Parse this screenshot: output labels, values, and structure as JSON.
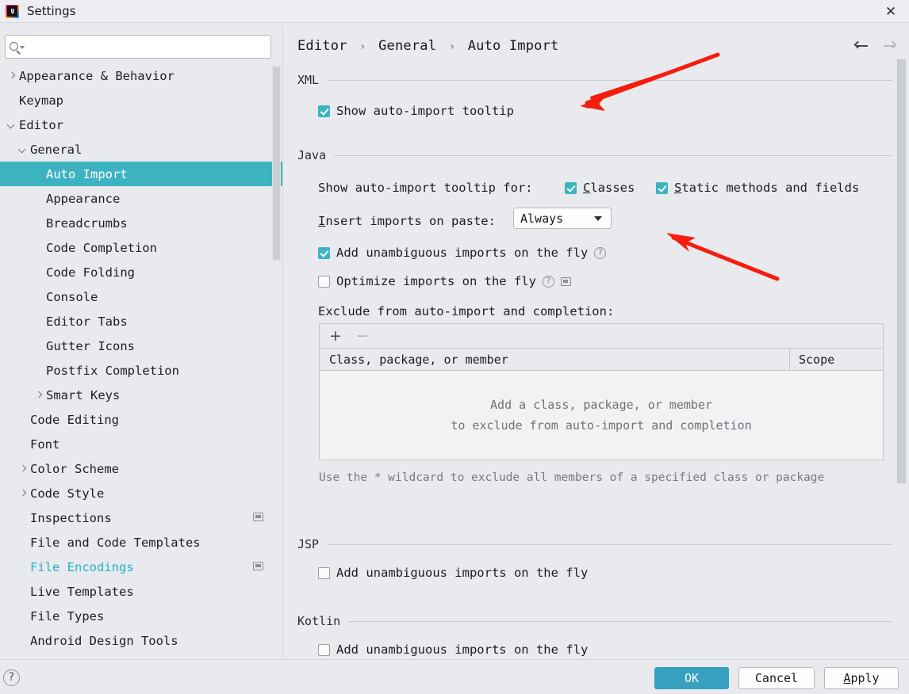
{
  "window": {
    "title": "Settings",
    "app_icon": "intellij-idea-logo",
    "close_icon": "close-icon"
  },
  "search": {
    "value": "",
    "placeholder": "",
    "icon": "search-icon"
  },
  "sidebar": {
    "items": [
      {
        "label": "Appearance & Behavior",
        "indent": 0,
        "arrow": "collapsed",
        "state": "normal",
        "badge": false
      },
      {
        "label": "Keymap",
        "indent": 0,
        "arrow": "none",
        "state": "normal",
        "badge": false
      },
      {
        "label": "Editor",
        "indent": 0,
        "arrow": "expanded",
        "state": "normal",
        "badge": false
      },
      {
        "label": "General",
        "indent": 1,
        "arrow": "expanded",
        "state": "normal",
        "badge": false
      },
      {
        "label": "Auto Import",
        "indent": 2,
        "arrow": "none",
        "state": "selected",
        "badge": false
      },
      {
        "label": "Appearance",
        "indent": 2,
        "arrow": "none",
        "state": "normal",
        "badge": false
      },
      {
        "label": "Breadcrumbs",
        "indent": 2,
        "arrow": "none",
        "state": "normal",
        "badge": false
      },
      {
        "label": "Code Completion",
        "indent": 2,
        "arrow": "none",
        "state": "normal",
        "badge": false
      },
      {
        "label": "Code Folding",
        "indent": 2,
        "arrow": "none",
        "state": "normal",
        "badge": false
      },
      {
        "label": "Console",
        "indent": 2,
        "arrow": "none",
        "state": "normal",
        "badge": false
      },
      {
        "label": "Editor Tabs",
        "indent": 2,
        "arrow": "none",
        "state": "normal",
        "badge": false
      },
      {
        "label": "Gutter Icons",
        "indent": 2,
        "arrow": "none",
        "state": "normal",
        "badge": false
      },
      {
        "label": "Postfix Completion",
        "indent": 2,
        "arrow": "none",
        "state": "normal",
        "badge": false
      },
      {
        "label": "Smart Keys",
        "indent": 2,
        "arrow": "collapsed",
        "state": "normal",
        "badge": false
      },
      {
        "label": "Code Editing",
        "indent": 1,
        "arrow": "none",
        "state": "normal",
        "badge": false
      },
      {
        "label": "Font",
        "indent": 1,
        "arrow": "none",
        "state": "normal",
        "badge": false
      },
      {
        "label": "Color Scheme",
        "indent": 1,
        "arrow": "collapsed",
        "state": "normal",
        "badge": false
      },
      {
        "label": "Code Style",
        "indent": 1,
        "arrow": "collapsed",
        "state": "normal",
        "badge": false
      },
      {
        "label": "Inspections",
        "indent": 1,
        "arrow": "none",
        "state": "normal",
        "badge": true
      },
      {
        "label": "File and Code Templates",
        "indent": 1,
        "arrow": "none",
        "state": "normal",
        "badge": false
      },
      {
        "label": "File Encodings",
        "indent": 1,
        "arrow": "none",
        "state": "accent",
        "badge": true
      },
      {
        "label": "Live Templates",
        "indent": 1,
        "arrow": "none",
        "state": "normal",
        "badge": false
      },
      {
        "label": "File Types",
        "indent": 1,
        "arrow": "none",
        "state": "normal",
        "badge": false
      },
      {
        "label": "Android Design Tools",
        "indent": 1,
        "arrow": "none",
        "state": "normal",
        "badge": false
      }
    ]
  },
  "main": {
    "breadcrumb": {
      "part1": "Editor",
      "part2": "General",
      "part3": "Auto Import",
      "separator": "›"
    },
    "nav": {
      "back_icon": "arrow-left-icon",
      "forward_icon": "arrow-right-icon"
    },
    "xml": {
      "section": "XML",
      "show_tooltip": {
        "label": "Show auto-import tooltip",
        "checked": true
      }
    },
    "java": {
      "section": "Java",
      "tooltip_for_label": "Show auto-import tooltip for:",
      "classes": {
        "label": "Classes",
        "mnemonic": "C",
        "rest": "lasses",
        "checked": true
      },
      "static_methods": {
        "label": "Static methods and fields",
        "mnemonic": "S",
        "rest": "tatic methods and fields",
        "checked": true
      },
      "insert_label_mnemonic": "I",
      "insert_label_rest": "nsert imports on paste:",
      "insert_on_paste_value": "Always",
      "add_unambiguous": {
        "label": "Add unambiguous imports on the fly",
        "checked": true,
        "help": "?"
      },
      "optimize": {
        "label": "Optimize imports on the fly",
        "checked": false,
        "help": "?"
      },
      "exclude_label": "Exclude from auto-import and completion:",
      "table": {
        "add_button": "+",
        "remove_button": "−",
        "columns": [
          "Class, package, or member",
          "Scope"
        ],
        "empty_line1": "Add a class, package, or member",
        "empty_line2": "to exclude from auto-import and completion"
      },
      "wildcard_hint": "Use the * wildcard to exclude all members of a specified class or package"
    },
    "jsp": {
      "section": "JSP",
      "add_unambiguous": {
        "label": "Add unambiguous imports on the fly",
        "checked": false
      }
    },
    "kotlin": {
      "section": "Kotlin",
      "add_unambiguous": {
        "label": "Add unambiguous imports on the fly",
        "checked": false
      }
    }
  },
  "footer": {
    "help_icon": "?",
    "ok": "OK",
    "cancel": "Cancel",
    "apply_mnemonic": "A",
    "apply_rest": "pply"
  },
  "colors": {
    "accent": "#3eb3c0",
    "primary_button": "#35a0c0",
    "annotation_arrow": "#f51d0e",
    "background": "#e8eaed"
  }
}
